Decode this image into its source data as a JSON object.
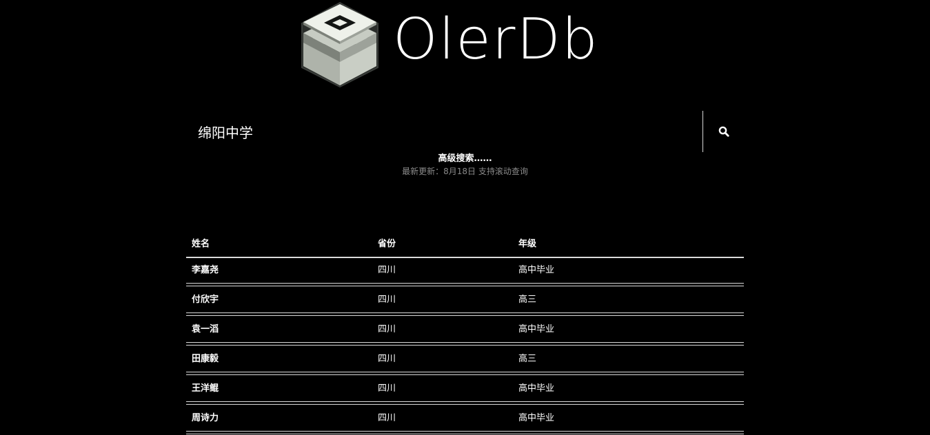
{
  "brand": {
    "name": "OlerDb"
  },
  "search": {
    "value": "绵阳中学",
    "placeholder": ""
  },
  "advanced_search_label": "高级搜索……",
  "update_note": "最新更新：8月18日 支持滚动查询",
  "table": {
    "headers": [
      "姓名",
      "省份",
      "年级"
    ],
    "rows": [
      [
        "李嘉尧",
        "四川",
        "高中毕业"
      ],
      [
        "付欣宇",
        "四川",
        "高三"
      ],
      [
        "袁一滔",
        "四川",
        "高中毕业"
      ],
      [
        "田康毅",
        "四川",
        "高三"
      ],
      [
        "王洋鲲",
        "四川",
        "高中毕业"
      ],
      [
        "周诗力",
        "四川",
        "高中毕业"
      ]
    ]
  },
  "icons": {
    "logo": "layered-cube-logo-icon",
    "search": "search-icon"
  },
  "colors": {
    "background": "#000000",
    "text": "#ffffff",
    "muted_text": "#8a8a8a",
    "rule": "#dcdcdc",
    "logo_light": "#e9ede6",
    "logo_mid": "#c4c9c0",
    "logo_dark": "#7d827a"
  }
}
